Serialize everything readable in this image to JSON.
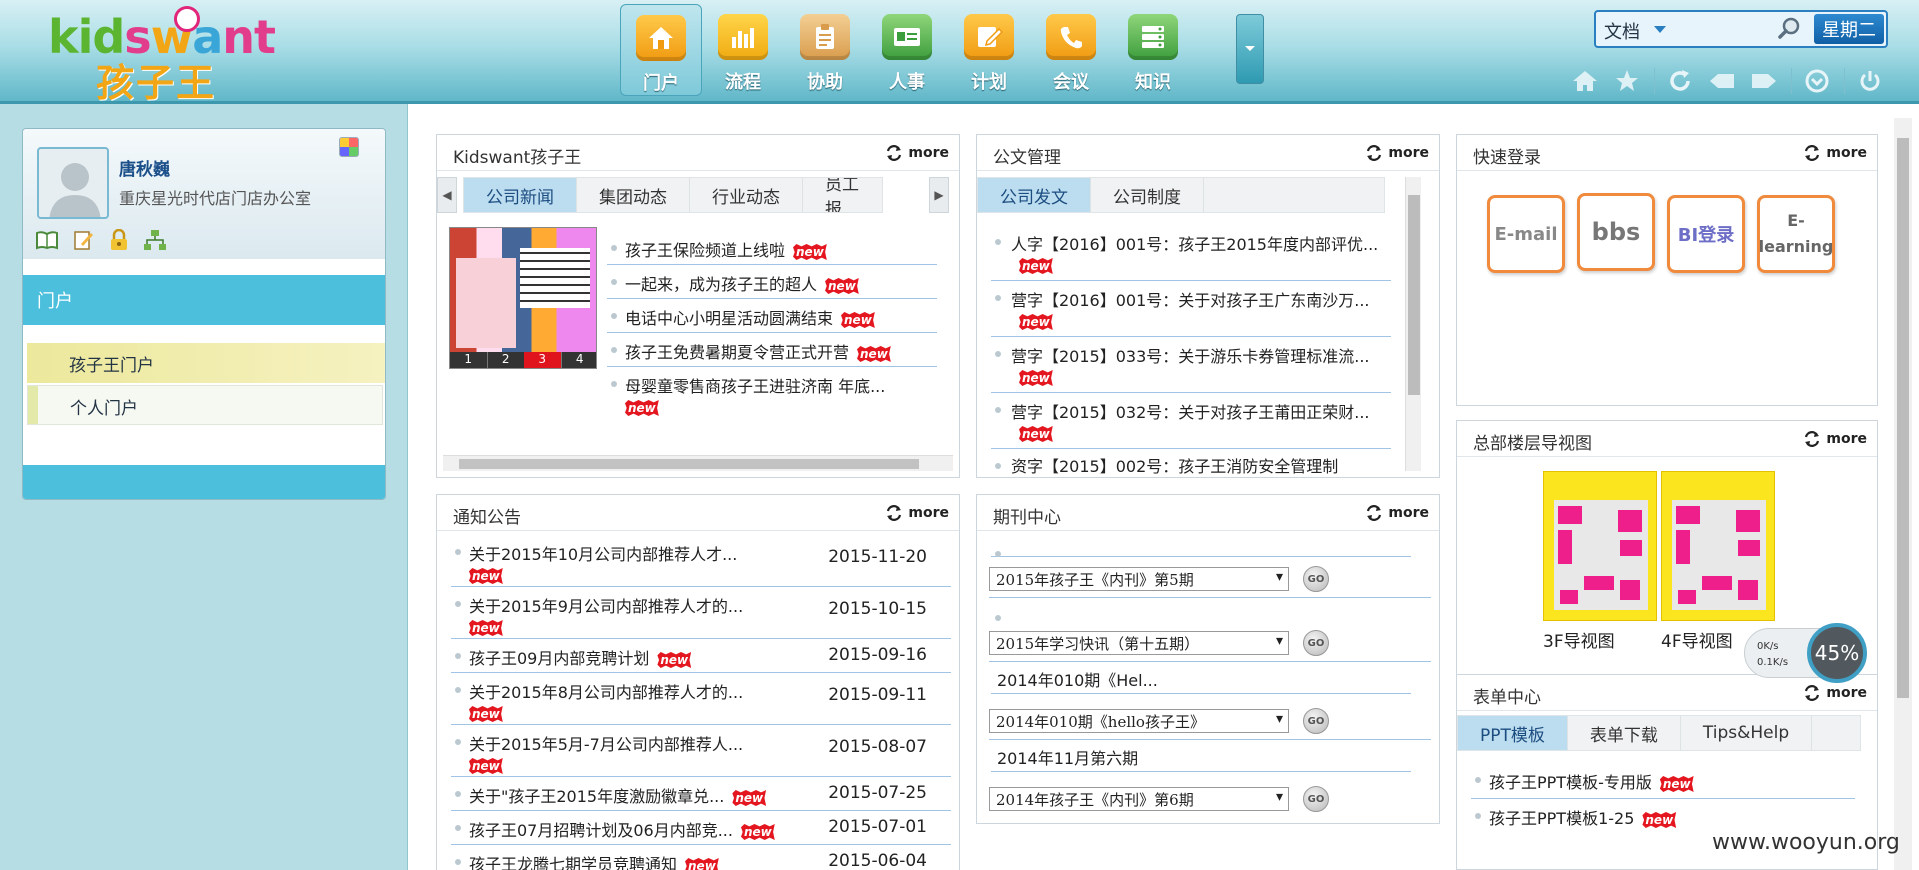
{
  "brand": {
    "logo_en": "Kidswant",
    "logo_cn": "孩子王"
  },
  "nav": [
    {
      "label": "门户",
      "icon": "home-icon",
      "color": "#f4a21d",
      "active": true
    },
    {
      "label": "流程",
      "icon": "bar-chart-icon",
      "color": "#f4b21d"
    },
    {
      "label": "协助",
      "icon": "clipboard-icon",
      "color": "#e9b46a"
    },
    {
      "label": "人事",
      "icon": "id-card-icon",
      "color": "#5cb85c"
    },
    {
      "label": "计划",
      "icon": "edit-icon",
      "color": "#f4a21d"
    },
    {
      "label": "会议",
      "icon": "phone-icon",
      "color": "#f4a21d"
    },
    {
      "label": "知识",
      "icon": "database-icon",
      "color": "#5cb85c"
    }
  ],
  "search": {
    "scope": "文档",
    "placeholder": "",
    "weekday": "星期二"
  },
  "user": {
    "name": "唐秋巍",
    "dept": "重庆星光时代店门店办公室"
  },
  "sidebar": {
    "section": "门户",
    "items": [
      "孩子王门户",
      "个人门户"
    ]
  },
  "common": {
    "more": "more",
    "new": "new",
    "go": "GO"
  },
  "news": {
    "title": "Kidswant孩子王",
    "tabs": [
      "公司新闻",
      "集团动态",
      "行业动态",
      "员工报"
    ],
    "slides": [
      "1",
      "2",
      "3",
      "4"
    ],
    "items": [
      {
        "text": "孩子王保险频道上线啦",
        "new": true
      },
      {
        "text": "一起来，成为孩子王的超人",
        "new": true
      },
      {
        "text": "电话中心小明星活动圆满结束",
        "new": true
      },
      {
        "text": "孩子王免费暑期夏令营正式开营",
        "new": true
      },
      {
        "text": "母婴童零售商孩子王进驻济南 年底...",
        "new": true
      }
    ]
  },
  "docs": {
    "title": "公文管理",
    "tabs": [
      "公司发文",
      "公司制度"
    ],
    "items": [
      {
        "text": "人字【2016】001号：孩子王2015年度内部评优...",
        "new": true
      },
      {
        "text": "营字【2016】001号：关于对孩子王广东南沙万...",
        "new": true
      },
      {
        "text": "营字【2015】033号：关于游乐卡券管理标准流...",
        "new": true
      },
      {
        "text": "营字【2015】032号：关于对孩子王莆田正荣财...",
        "new": true
      },
      {
        "text": "资字【2015】002号：孩子王消防安全管理制",
        "new": false
      }
    ]
  },
  "quick": {
    "title": "快速登录",
    "links": [
      {
        "label": "E-mail"
      },
      {
        "label": "bbs"
      },
      {
        "label": "BI登录"
      },
      {
        "label": "E-learning"
      }
    ]
  },
  "notice": {
    "title": "通知公告",
    "items": [
      {
        "text": "关于2015年10月公司内部推荐人才...",
        "date": "2015-11-20",
        "new": true
      },
      {
        "text": "关于2015年9月公司内部推荐人才的...",
        "date": "2015-10-15",
        "new": true
      },
      {
        "text": "孩子王09月内部竞聘计划",
        "date": "2015-09-16",
        "new": true
      },
      {
        "text": "关于2015年8月公司内部推荐人才的...",
        "date": "2015-09-11",
        "new": true
      },
      {
        "text": "关于2015年5月-7月公司内部推荐人...",
        "date": "2015-08-07",
        "new": true
      },
      {
        "text": "关于\"孩子王2015年度激励徽章兑...",
        "date": "2015-07-25",
        "new": true
      },
      {
        "text": "孩子王07月招聘计划及06月内部竞...",
        "date": "2015-07-01",
        "new": true
      },
      {
        "text": "孩子王龙腾七期学员竞聘通知",
        "date": "2015-06-04",
        "new": true
      }
    ]
  },
  "journal": {
    "title": "期刊中心",
    "groups": [
      {
        "heading": "",
        "select": "2015年孩子王《内刊》第5期"
      },
      {
        "heading": "",
        "select": "2015年学习快讯（第十五期）"
      },
      {
        "heading": "2014年010期《Hel...",
        "select": "2014年010期《hello孩子王》"
      },
      {
        "heading": "2014年11月第六期",
        "select": "2014年孩子王《内刊》第6期"
      }
    ]
  },
  "floor": {
    "title": "总部楼层导视图",
    "maps": [
      {
        "label": "3F导视图"
      },
      {
        "label": "4F导视图"
      }
    ]
  },
  "forms": {
    "title": "表单中心",
    "tabs": [
      "PPT模板",
      "表单下载",
      "Tips&Help"
    ],
    "items": [
      {
        "text": "孩子王PPT模板-专用版",
        "new": true
      },
      {
        "text": "孩子王PPT模板1-25",
        "new": true
      }
    ]
  },
  "speed": {
    "up": "0K/s",
    "down": "0.1K/s",
    "percent": "45%"
  },
  "watermark": "www.wooyun.org"
}
